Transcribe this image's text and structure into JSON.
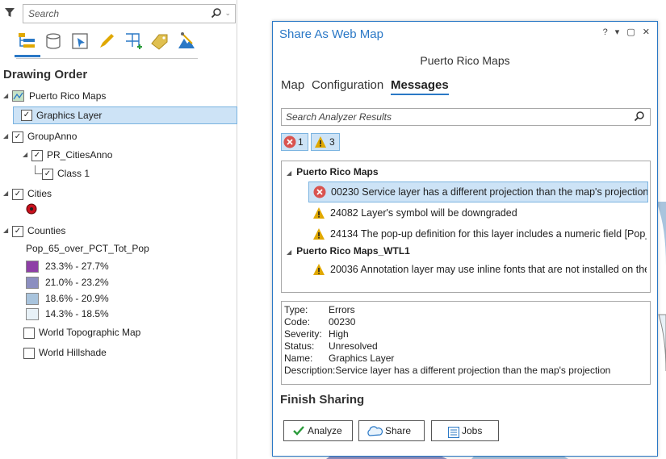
{
  "contents": {
    "search_placeholder": "Search",
    "view_icons": [
      "list-by-drawing-order-icon",
      "list-by-data-source-icon",
      "list-by-selection-icon",
      "list-by-editing-icon",
      "list-by-snapping-icon",
      "list-by-labeling-icon",
      "list-by-perspective-imagery-icon"
    ],
    "heading": "Drawing Order",
    "map_name": "Puerto Rico Maps",
    "layers": {
      "graphics": "Graphics Layer",
      "group_anno": "GroupAnno",
      "pr_cities_anno": "PR_CitiesAnno",
      "class1": "Class 1",
      "cities": "Cities",
      "counties": "Counties",
      "counties_field": "Pop_65_over_PCT_Tot_Pop",
      "counties_classes": [
        {
          "label": "23.3% - 27.7%",
          "color": "#8e3fa6"
        },
        {
          "label": "21.0% - 23.2%",
          "color": "#8c8fc0"
        },
        {
          "label": "18.6% - 20.9%",
          "color": "#a9c4dd"
        },
        {
          "label": "14.3% - 18.5%",
          "color": "#e8f1f7"
        }
      ],
      "topo": "World Topographic Map",
      "hillshade": "World Hillshade"
    }
  },
  "dialog": {
    "title": "Share As Web Map",
    "controls": "? ▾ ▢ ✕",
    "map_name": "Puerto Rico Maps",
    "tabs": [
      "Map",
      "Configuration",
      "Messages"
    ],
    "active_tab": "Messages",
    "search_placeholder": "Search Analyzer Results",
    "error_count": "1",
    "warning_count": "3",
    "groups": [
      {
        "name": "Puerto Rico Maps",
        "items": [
          {
            "kind": "error",
            "text": "00230 Service layer has a different projection than the map's projection"
          },
          {
            "kind": "warning",
            "text": "24082 Layer's symbol will be downgraded"
          },
          {
            "kind": "warning",
            "text": "24134 The pop-up definition for this layer includes a numeric field [Pop_"
          }
        ]
      },
      {
        "name": "Puerto Rico Maps_WTL1",
        "items": [
          {
            "kind": "warning",
            "text": "20036 Annotation layer may use inline fonts that are not installed on the"
          }
        ]
      }
    ],
    "details": [
      {
        "key": "Type:",
        "value": "Errors"
      },
      {
        "key": "Code:",
        "value": "00230"
      },
      {
        "key": "Severity:",
        "value": "High"
      },
      {
        "key": "Status:",
        "value": "Unresolved"
      },
      {
        "key": "Name:",
        "value": "Graphics Layer"
      },
      {
        "key": "Description:",
        "value": "Service layer has a different projection than the map's projection"
      }
    ],
    "finish_title": "Finish Sharing",
    "buttons": {
      "analyze": "Analyze",
      "share": "Share",
      "jobs": "Jobs"
    }
  },
  "colors": {
    "accent": "#2a78c6",
    "error": "#d9534f",
    "warning": "#e0a800",
    "selection": "#cde3f6"
  }
}
